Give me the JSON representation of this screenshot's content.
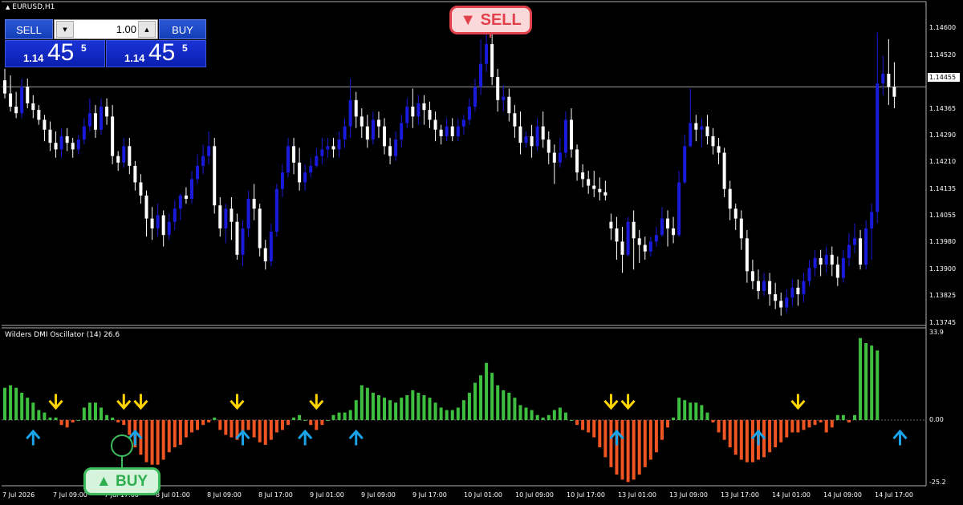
{
  "chart": {
    "symbol_title": "EURUSD,H1",
    "indicator_title": "Wilders DMI Oscillator (14) 26.6",
    "current_price_tag": "1.14455",
    "colors": {
      "bull_candle": "#1a1adc",
      "bear_candle": "#ffffff",
      "osc_positive": "#3fbf3f",
      "osc_negative": "#ee5522",
      "arrow_up": "#1aa3e8",
      "arrow_down": "#ffd400",
      "sell_badge": "#e0414a",
      "buy_badge": "#3ebc5b"
    }
  },
  "trade_panel": {
    "sell_label": "SELL",
    "buy_label": "BUY",
    "lot_value": "1.00",
    "sell_price": {
      "prefix": "1.14",
      "big": "45",
      "sup": "5"
    },
    "buy_price": {
      "prefix": "1.14",
      "big": "45",
      "sup": "5"
    }
  },
  "price_axis": [
    "1.14600",
    "1.14520",
    "1.14365",
    "1.14290",
    "1.14210",
    "1.14135",
    "1.14055",
    "1.13980",
    "1.13900",
    "1.13825",
    "1.13745"
  ],
  "oscillator_axis": [
    "33.9",
    "0.00",
    "-25.2"
  ],
  "time_axis": [
    "7 Jul 2026",
    "7 Jul 09:00",
    "7 Jul 17:00",
    "8 Jul 01:00",
    "8 Jul 09:00",
    "8 Jul 17:00",
    "9 Jul 01:00",
    "9 Jul 09:00",
    "9 Jul 17:00",
    "10 Jul 01:00",
    "10 Jul 09:00",
    "10 Jul 17:00",
    "13 Jul 01:00",
    "13 Jul 09:00",
    "13 Jul 17:00",
    "14 Jul 01:00",
    "14 Jul 09:00",
    "14 Jul 17:00"
  ],
  "annotations": {
    "sell": "▼ SELL",
    "buy": "▲ BUY"
  },
  "chart_data": {
    "type": "candlestick",
    "price_range": [
      1.1374,
      1.1468
    ],
    "oscillator_range": [
      -25.2,
      33.9
    ],
    "candles": [
      [
        1.14475,
        1.14435,
        1.1451,
        1.1442
      ],
      [
        1.14435,
        1.14395,
        1.1449,
        1.1438
      ],
      [
        1.14395,
        1.14375,
        1.1444,
        1.1436
      ],
      [
        1.14375,
        1.14455,
        1.1448,
        1.1436
      ],
      [
        1.14455,
        1.14405,
        1.1448,
        1.1439
      ],
      [
        1.14405,
        1.14385,
        1.1443,
        1.1436
      ],
      [
        1.14385,
        1.14355,
        1.144,
        1.1434
      ],
      [
        1.14355,
        1.14325,
        1.1437,
        1.1429
      ],
      [
        1.14325,
        1.14285,
        1.1435,
        1.1426
      ],
      [
        1.14285,
        1.14265,
        1.1432,
        1.1424
      ],
      [
        1.14265,
        1.14305,
        1.1433,
        1.1424
      ],
      [
        1.14305,
        1.14285,
        1.1433,
        1.1426
      ],
      [
        1.14285,
        1.14265,
        1.143,
        1.1424
      ],
      [
        1.14265,
        1.14295,
        1.1431,
        1.1425
      ],
      [
        1.14295,
        1.14335,
        1.1436,
        1.1428
      ],
      [
        1.14335,
        1.14375,
        1.1442,
        1.1432
      ],
      [
        1.14375,
        1.14325,
        1.144,
        1.143
      ],
      [
        1.14325,
        1.14395,
        1.1442,
        1.1431
      ],
      [
        1.14395,
        1.14365,
        1.1442,
        1.1434
      ],
      [
        1.14365,
        1.14245,
        1.144,
        1.1422
      ],
      [
        1.14245,
        1.14225,
        1.1426,
        1.142
      ],
      [
        1.14225,
        1.14275,
        1.143,
        1.1421
      ],
      [
        1.14275,
        1.14215,
        1.143,
        1.1419
      ],
      [
        1.14215,
        1.14165,
        1.1423,
        1.1414
      ],
      [
        1.14165,
        1.14125,
        1.1419,
        1.141
      ],
      [
        1.14125,
        1.14055,
        1.1414,
        1.14
      ],
      [
        1.14055,
        1.14025,
        1.1409,
        1.1399
      ],
      [
        1.14025,
        1.14065,
        1.141,
        1.14
      ],
      [
        1.14065,
        1.14005,
        1.1408,
        1.1397
      ],
      [
        1.14005,
        1.14045,
        1.1407,
        1.1399
      ],
      [
        1.14045,
        1.14085,
        1.1411,
        1.1402
      ],
      [
        1.14085,
        1.14125,
        1.1413,
        1.1405
      ],
      [
        1.14125,
        1.14115,
        1.1415,
        1.141
      ],
      [
        1.14115,
        1.14175,
        1.142,
        1.141
      ],
      [
        1.14175,
        1.14215,
        1.1425,
        1.1416
      ],
      [
        1.14215,
        1.14245,
        1.1428,
        1.1419
      ],
      [
        1.14245,
        1.14275,
        1.1432,
        1.1422
      ],
      [
        1.14275,
        1.14095,
        1.143,
        1.1407
      ],
      [
        1.14095,
        1.14025,
        1.1412,
        1.14
      ],
      [
        1.14025,
        1.14085,
        1.141,
        1.1398
      ],
      [
        1.14085,
        1.14045,
        1.1412,
        1.1399
      ],
      [
        1.14045,
        1.13945,
        1.1407,
        1.1393
      ],
      [
        1.13945,
        1.14025,
        1.1405,
        1.1391
      ],
      [
        1.14025,
        1.14115,
        1.1414,
        1.14
      ],
      [
        1.14115,
        1.14085,
        1.1416,
        1.1405
      ],
      [
        1.14085,
        1.13965,
        1.141,
        1.1394
      ],
      [
        1.13965,
        1.13925,
        1.1399,
        1.139
      ],
      [
        1.13925,
        1.14015,
        1.1404,
        1.1391
      ],
      [
        1.14015,
        1.14145,
        1.1416,
        1.14
      ],
      [
        1.14145,
        1.14195,
        1.1422,
        1.1412
      ],
      [
        1.14195,
        1.14275,
        1.143,
        1.1418
      ],
      [
        1.14275,
        1.14225,
        1.143,
        1.1419
      ],
      [
        1.14225,
        1.14165,
        1.1427,
        1.1414
      ],
      [
        1.14165,
        1.14195,
        1.1422,
        1.1414
      ],
      [
        1.14195,
        1.14215,
        1.1424,
        1.1418
      ],
      [
        1.14215,
        1.14245,
        1.1427,
        1.1421
      ],
      [
        1.14245,
        1.14265,
        1.143,
        1.1422
      ],
      [
        1.14265,
        1.14275,
        1.143,
        1.1424
      ],
      [
        1.14275,
        1.14265,
        1.143,
        1.1424
      ],
      [
        1.14265,
        1.14295,
        1.1432,
        1.1424
      ],
      [
        1.14295,
        1.14335,
        1.1436,
        1.1427
      ],
      [
        1.14335,
        1.14415,
        1.1448,
        1.143
      ],
      [
        1.14415,
        1.14365,
        1.1444,
        1.1433
      ],
      [
        1.14365,
        1.14335,
        1.1439,
        1.143
      ],
      [
        1.14335,
        1.14295,
        1.1437,
        1.1427
      ],
      [
        1.14295,
        1.14355,
        1.1438,
        1.1428
      ],
      [
        1.14355,
        1.14335,
        1.1438,
        1.143
      ],
      [
        1.14335,
        1.14275,
        1.1436,
        1.1425
      ],
      [
        1.14275,
        1.14245,
        1.143,
        1.1422
      ],
      [
        1.14245,
        1.14295,
        1.1432,
        1.1423
      ],
      [
        1.14295,
        1.14345,
        1.1437,
        1.1427
      ],
      [
        1.14345,
        1.14395,
        1.1442,
        1.1433
      ],
      [
        1.14395,
        1.14365,
        1.1445,
        1.1433
      ],
      [
        1.14365,
        1.14405,
        1.1443,
        1.1434
      ],
      [
        1.14405,
        1.14385,
        1.1443,
        1.1434
      ],
      [
        1.14385,
        1.14355,
        1.1441,
        1.1433
      ],
      [
        1.14355,
        1.14325,
        1.1438,
        1.1429
      ],
      [
        1.14325,
        1.14305,
        1.1434,
        1.1428
      ],
      [
        1.14305,
        1.14335,
        1.1436,
        1.1429
      ],
      [
        1.14335,
        1.14305,
        1.1436,
        1.1429
      ],
      [
        1.14305,
        1.14335,
        1.1436,
        1.1429
      ],
      [
        1.14335,
        1.14355,
        1.1437,
        1.1431
      ],
      [
        1.14355,
        1.14395,
        1.1442,
        1.1434
      ],
      [
        1.14395,
        1.14455,
        1.1448,
        1.1438
      ],
      [
        1.14455,
        1.14525,
        1.146,
        1.1443
      ],
      [
        1.14525,
        1.14585,
        1.1468,
        1.145
      ],
      [
        1.14585,
        1.14485,
        1.1463,
        1.1446
      ],
      [
        1.14485,
        1.14415,
        1.1451,
        1.1438
      ],
      [
        1.14415,
        1.14425,
        1.1446,
        1.1438
      ],
      [
        1.14425,
        1.14375,
        1.1445,
        1.1435
      ],
      [
        1.14375,
        1.14335,
        1.144,
        1.143
      ],
      [
        1.14335,
        1.14285,
        1.1438,
        1.1425
      ],
      [
        1.14285,
        1.14305,
        1.1432,
        1.1427
      ],
      [
        1.14305,
        1.14275,
        1.1434,
        1.1424
      ],
      [
        1.14275,
        1.14335,
        1.1436,
        1.1426
      ],
      [
        1.14335,
        1.14295,
        1.1438,
        1.1427
      ],
      [
        1.14295,
        1.14255,
        1.1432,
        1.1422
      ],
      [
        1.14255,
        1.14225,
        1.1428,
        1.1416
      ],
      [
        1.14225,
        1.14255,
        1.143,
        1.1421
      ],
      [
        1.14255,
        1.14355,
        1.1438,
        1.1424
      ],
      [
        1.14355,
        1.14265,
        1.1439,
        1.1424
      ],
      [
        1.14265,
        1.14195,
        1.1428,
        1.1417
      ],
      [
        1.14195,
        1.14175,
        1.1422,
        1.1415
      ],
      [
        1.14175,
        1.14155,
        1.142,
        1.1413
      ],
      [
        1.14155,
        1.14145,
        1.142,
        1.1412
      ],
      [
        1.14145,
        1.14135,
        1.1418,
        1.1411
      ],
      [
        1.14135,
        1.14125,
        1.1417,
        1.1411
      ],
      [
        1.14045,
        1.14025,
        1.1407,
        1.1399
      ],
      [
        1.14025,
        1.13985,
        1.1406,
        1.1393
      ],
      [
        1.13985,
        1.13945,
        1.1403,
        1.1389
      ],
      [
        1.13945,
        1.14045,
        1.1406,
        1.1394
      ],
      [
        1.14045,
        1.13995,
        1.1408,
        1.139
      ],
      [
        1.13995,
        1.13975,
        1.1402,
        1.1392
      ],
      [
        1.13975,
        1.13955,
        1.14,
        1.1393
      ],
      [
        1.13955,
        1.13985,
        1.14,
        1.1394
      ],
      [
        1.13985,
        1.14005,
        1.1403,
        1.1397
      ],
      [
        1.14005,
        1.14055,
        1.1409,
        1.14
      ],
      [
        1.14055,
        1.14025,
        1.1408,
        1.1397
      ],
      [
        1.14025,
        1.14005,
        1.1406,
        1.1398
      ],
      [
        1.14005,
        1.14165,
        1.142,
        1.14
      ],
      [
        1.14165,
        1.14275,
        1.1431,
        1.1416
      ],
      [
        1.14275,
        1.14345,
        1.1445,
        1.1427
      ],
      [
        1.14345,
        1.14325,
        1.1437,
        1.1429
      ],
      [
        1.14325,
        1.14335,
        1.1436,
        1.1427
      ],
      [
        1.14335,
        1.14305,
        1.1437,
        1.1428
      ],
      [
        1.14305,
        1.14275,
        1.1433,
        1.1425
      ],
      [
        1.14275,
        1.14255,
        1.143,
        1.1422
      ],
      [
        1.14255,
        1.14145,
        1.1427,
        1.1412
      ],
      [
        1.14145,
        1.14085,
        1.1417,
        1.1405
      ],
      [
        1.14085,
        1.14055,
        1.141,
        1.1402
      ],
      [
        1.14055,
        1.13995,
        1.1408,
        1.1396
      ],
      [
        1.13995,
        1.13895,
        1.1402,
        1.1386
      ],
      [
        1.13895,
        1.13865,
        1.1393,
        1.1384
      ],
      [
        1.13865,
        1.13835,
        1.139,
        1.1381
      ],
      [
        1.13835,
        1.13865,
        1.1389,
        1.1382
      ],
      [
        1.13865,
        1.13825,
        1.1389,
        1.1379
      ],
      [
        1.13825,
        1.13805,
        1.1386,
        1.1378
      ],
      [
        1.13805,
        1.13785,
        1.1383,
        1.1376
      ],
      [
        1.13785,
        1.13815,
        1.1384,
        1.1377
      ],
      [
        1.13815,
        1.13845,
        1.1387,
        1.1379
      ],
      [
        1.13845,
        1.13825,
        1.1387,
        1.1379
      ],
      [
        1.13825,
        1.13865,
        1.1389,
        1.138
      ],
      [
        1.13865,
        1.13905,
        1.1393,
        1.1385
      ],
      [
        1.13905,
        1.13935,
        1.1396,
        1.1388
      ],
      [
        1.13935,
        1.13915,
        1.1396,
        1.1388
      ],
      [
        1.13915,
        1.13945,
        1.1397,
        1.1389
      ],
      [
        1.13945,
        1.13915,
        1.1397,
        1.1388
      ],
      [
        1.13915,
        1.13875,
        1.1394,
        1.1385
      ],
      [
        1.13875,
        1.13935,
        1.1396,
        1.1386
      ],
      [
        1.13935,
        1.13975,
        1.1401,
        1.1391
      ],
      [
        1.13975,
        1.13995,
        1.1404,
        1.1395
      ],
      [
        1.13995,
        1.13915,
        1.1402,
        1.139
      ],
      [
        1.13915,
        1.14025,
        1.1405,
        1.139
      ],
      [
        1.14025,
        1.14075,
        1.141,
        1.1393
      ],
      [
        1.14075,
        1.14465,
        1.1462,
        1.1404
      ],
      [
        1.14465,
        1.14495,
        1.1455,
        1.1443
      ],
      [
        1.14495,
        1.14455,
        1.146,
        1.144
      ],
      [
        1.14455,
        1.14425,
        1.1453,
        1.1439
      ]
    ],
    "oscillator": [
      13,
      14,
      13,
      11,
      9,
      7,
      4,
      3,
      1,
      1,
      -2,
      -3,
      -1,
      0,
      5,
      7,
      7,
      5,
      2,
      1,
      -1,
      -2,
      -6,
      -11,
      -14,
      -17,
      -18,
      -18,
      -16,
      -13,
      -11,
      -10,
      -7,
      -5,
      -4,
      -2,
      -1,
      1,
      -4,
      -6,
      -7,
      -8,
      -5,
      -4,
      -7,
      -9,
      -10,
      -8,
      -5,
      -4,
      -2,
      1,
      2,
      0,
      -2,
      -4,
      -2,
      0,
      2,
      3,
      3,
      4,
      8,
      14,
      13,
      11,
      10,
      9,
      8,
      7,
      9,
      10,
      12,
      11,
      10,
      9,
      7,
      5,
      4,
      4,
      5,
      8,
      11,
      15,
      18,
      23,
      19,
      14,
      12,
      11,
      9,
      6,
      5,
      4,
      2,
      1,
      2,
      4,
      5,
      3,
      0,
      -2,
      -4,
      -5,
      -7,
      -11,
      -15,
      -19,
      -22,
      -24,
      -25,
      -24,
      -22,
      -19,
      -16,
      -13,
      -8,
      -3,
      1,
      9,
      8,
      7,
      7,
      6,
      3,
      -1,
      -5,
      -8,
      -11,
      -14,
      -16,
      -17,
      -17,
      -16,
      -15,
      -13,
      -11,
      -9,
      -7,
      -5,
      -5,
      -4,
      -3,
      -2,
      -1,
      -5,
      -3,
      2,
      2,
      -1,
      2,
      33,
      31,
      30,
      28
    ],
    "buy_signal_candles": [
      5,
      23,
      42,
      53,
      62,
      108,
      133,
      158
    ],
    "sell_signal_candles": [
      9,
      21,
      24,
      41,
      55,
      107,
      110,
      140
    ],
    "reference_price": 1.14455
  }
}
